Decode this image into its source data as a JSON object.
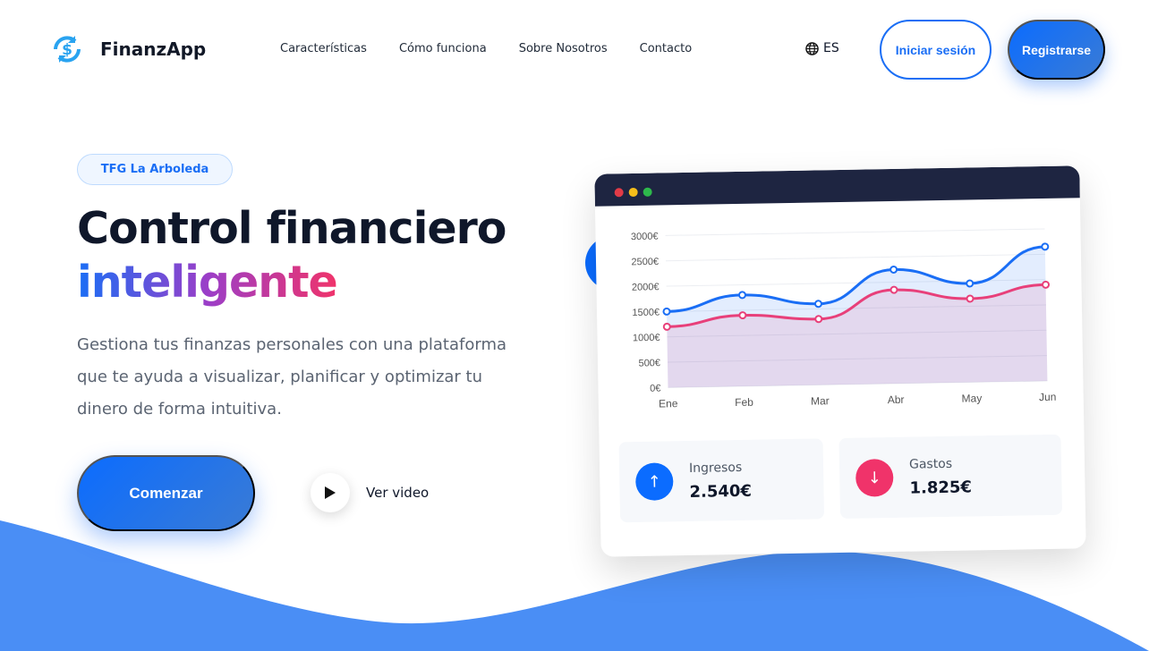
{
  "brand": {
    "name": "FinanzApp",
    "icon": "dollar-cycle-icon"
  },
  "nav": {
    "links": [
      "Características",
      "Cómo funciona",
      "Sobre Nosotros",
      "Contacto"
    ],
    "language": "ES",
    "login": "Iniciar sesión",
    "register": "Registrarse"
  },
  "hero": {
    "badge": "TFG La Arboleda",
    "title_line1": "Control financiero",
    "title_line2": "inteligente",
    "description": "Gestiona tus finanzas personales con una plataforma que te ayuda a visualizar, planificar y optimizar tu dinero de forma intuitiva.",
    "cta": "Comenzar",
    "video": "Ver video"
  },
  "colors": {
    "accent": "#1a6ef5",
    "pink": "#f0336a",
    "dark": "#1e2541"
  },
  "chart_data": {
    "type": "area",
    "categories": [
      "Ene",
      "Feb",
      "Mar",
      "Abr",
      "May",
      "Jun"
    ],
    "yticks": [
      "0€",
      "500€",
      "1000€",
      "1500€",
      "2000€",
      "2500€",
      "3000€"
    ],
    "ylim": [
      0,
      3000
    ],
    "grid": true,
    "series": [
      {
        "values": [
          1500,
          1800,
          1600,
          2250,
          1950,
          2650
        ],
        "color": "#1a6ef5"
      },
      {
        "values": [
          1200,
          1400,
          1300,
          1850,
          1650,
          1900
        ],
        "color": "#e8407a"
      }
    ]
  },
  "stats": [
    {
      "label": "Ingresos",
      "value": "2.540€",
      "icon": "arrow-up-icon",
      "color": "#0b6cff"
    },
    {
      "label": "Gastos",
      "value": "1.825€",
      "icon": "arrow-down-icon",
      "color": "#f0336a"
    }
  ]
}
